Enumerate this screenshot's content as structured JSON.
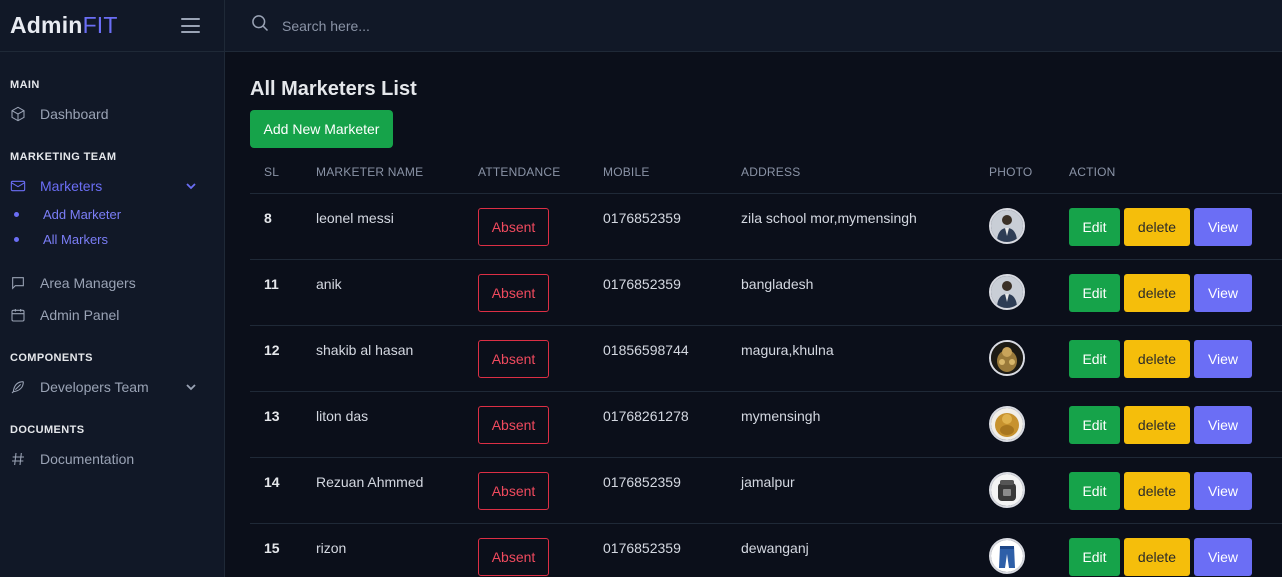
{
  "brand": {
    "name_main": "Admin",
    "name_accent": "FIT"
  },
  "search": {
    "placeholder": "Search here..."
  },
  "sidebar": {
    "sections": {
      "main": "MAIN",
      "marketing": "MARKETING TEAM",
      "components": "COMPONENTS",
      "documents": "DOCUMENTS"
    },
    "items": {
      "dashboard": "Dashboard",
      "marketers": "Marketers",
      "add_marketer": "Add Marketer",
      "all_markers": "All Markers",
      "area_managers": "Area Managers",
      "admin_panel": "Admin Panel",
      "developers_team": "Developers Team",
      "documentation": "Documentation"
    }
  },
  "main": {
    "title": "All Marketers List",
    "add_button": "Add New Marketer",
    "columns": [
      "SL",
      "MARKETER NAME",
      "ATTENDANCE",
      "MOBILE",
      "ADDRESS",
      "PHOTO",
      "ACTION"
    ],
    "rows": [
      {
        "sl": "8",
        "name": "leonel messi",
        "attendance": "Absent",
        "mobile": "0176852359",
        "address": "zila school mor,mymensingh",
        "photo": "person-photo"
      },
      {
        "sl": "11",
        "name": "anik",
        "attendance": "Absent",
        "mobile": "0176852359",
        "address": "bangladesh",
        "photo": "person-photo"
      },
      {
        "sl": "12",
        "name": "shakib al hasan",
        "attendance": "Absent",
        "mobile": "01856598744",
        "address": "magura,khulna",
        "photo": "golden-statue-photo"
      },
      {
        "sl": "13",
        "name": "liton das",
        "attendance": "Absent",
        "mobile": "01768261278",
        "address": "mymensingh",
        "photo": "golden-idol-photo"
      },
      {
        "sl": "14",
        "name": "Rezuan Ahmmed",
        "attendance": "Absent",
        "mobile": "0176852359",
        "address": "jamalpur",
        "photo": "pressure-cooker-photo"
      },
      {
        "sl": "15",
        "name": "rizon",
        "attendance": "Absent",
        "mobile": "0176852359",
        "address": "dewanganj",
        "photo": "jeans-photo"
      }
    ],
    "actions": {
      "edit": "Edit",
      "delete": "delete",
      "view": "View"
    }
  },
  "colors": {
    "background": "#0b0f1a",
    "sidebar": "#111827",
    "accent": "#6b6ef5",
    "success": "#16a34a",
    "warning": "#f5be0b",
    "danger": "#dc2f45"
  }
}
